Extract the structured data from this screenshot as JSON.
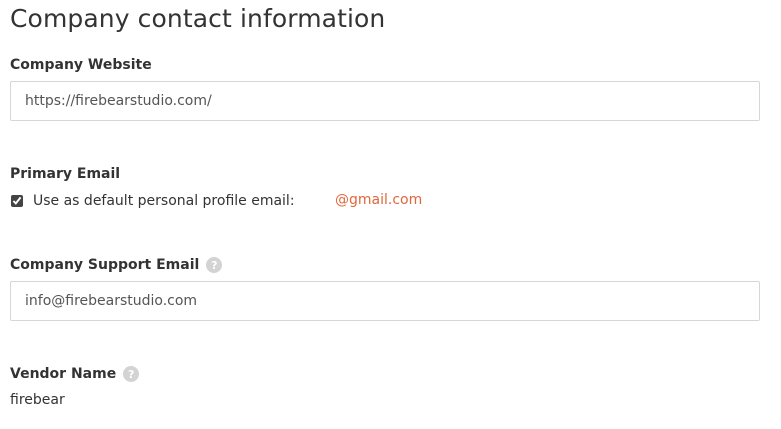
{
  "section": {
    "title": "Company contact information"
  },
  "company_website": {
    "label": "Company Website",
    "value": "https://firebearstudio.com/"
  },
  "primary_email": {
    "label": "Primary Email",
    "checkbox_label": "Use as default personal profile email:",
    "checked": true,
    "email_domain": "@gmail.com"
  },
  "support_email": {
    "label": "Company Support Email",
    "value": "info@firebearstudio.com",
    "help_icon": "question-circle-icon"
  },
  "vendor_name": {
    "label": "Vendor Name",
    "value": "firebear",
    "help_icon": "question-circle-icon"
  },
  "colors": {
    "accent": "#e0673d",
    "border": "#d6d6d6",
    "help_icon": "#d3d3d3"
  }
}
